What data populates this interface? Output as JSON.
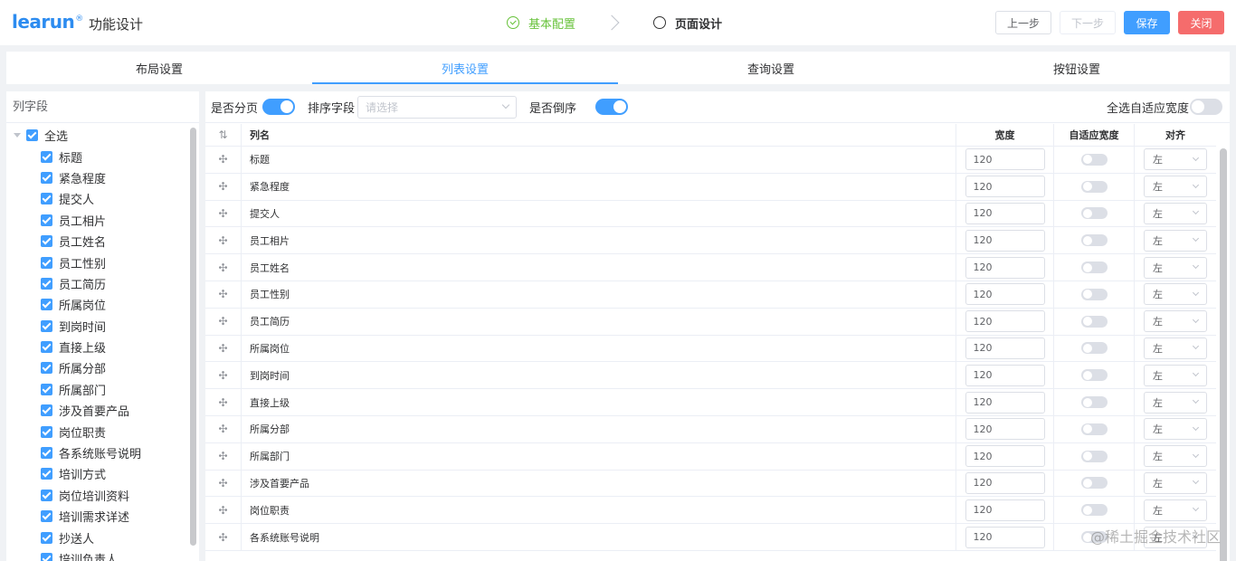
{
  "header": {
    "logo": "learun",
    "logo_mark": "®",
    "title": "功能设计",
    "steps": [
      {
        "label": "基本配置",
        "state": "done"
      },
      {
        "label": "页面设计",
        "state": "active"
      }
    ],
    "buttons": {
      "prev": "上一步",
      "next": "下一步",
      "save": "保存",
      "close": "关闭"
    }
  },
  "tabs": [
    "布局设置",
    "列表设置",
    "查询设置",
    "按钮设置"
  ],
  "active_tab": "列表设置",
  "left_panel": {
    "title": "列字段",
    "select_all": "全选",
    "items": [
      "标题",
      "紧急程度",
      "提交人",
      "员工相片",
      "员工姓名",
      "员工性别",
      "员工简历",
      "所属岗位",
      "到岗时间",
      "直接上级",
      "所属分部",
      "所属部门",
      "涉及首要产品",
      "岗位职责",
      "各系统账号说明",
      "培训方式",
      "岗位培训资料",
      "培训需求详述",
      "抄送人",
      "培训负责人"
    ]
  },
  "toolbar": {
    "paging_label": "是否分页",
    "paging_on": true,
    "sort_label": "排序字段",
    "sort_placeholder": "请选择",
    "desc_label": "是否倒序",
    "desc_on": true,
    "auto_width_all_label": "全选自适应宽度",
    "auto_width_all_on": false
  },
  "table": {
    "headers": {
      "name": "列名",
      "width": "宽度",
      "auto": "自适应宽度",
      "align": "对齐"
    },
    "rows": [
      {
        "name": "标题",
        "width": "120",
        "align": "左"
      },
      {
        "name": "紧急程度",
        "width": "120",
        "align": "左"
      },
      {
        "name": "提交人",
        "width": "120",
        "align": "左"
      },
      {
        "name": "员工相片",
        "width": "120",
        "align": "左"
      },
      {
        "name": "员工姓名",
        "width": "120",
        "align": "左"
      },
      {
        "name": "员工性别",
        "width": "120",
        "align": "左"
      },
      {
        "name": "员工简历",
        "width": "120",
        "align": "左"
      },
      {
        "name": "所属岗位",
        "width": "120",
        "align": "左"
      },
      {
        "name": "到岗时间",
        "width": "120",
        "align": "左"
      },
      {
        "name": "直接上级",
        "width": "120",
        "align": "左"
      },
      {
        "name": "所属分部",
        "width": "120",
        "align": "左"
      },
      {
        "name": "所属部门",
        "width": "120",
        "align": "左"
      },
      {
        "name": "涉及首要产品",
        "width": "120",
        "align": "左"
      },
      {
        "name": "岗位职责",
        "width": "120",
        "align": "左"
      },
      {
        "name": "各系统账号说明",
        "width": "120",
        "align": "左"
      }
    ]
  },
  "watermark": "@稀土掘金技术社区",
  "colors": {
    "primary": "#409eff",
    "success": "#67c23a",
    "danger": "#f56c6c"
  }
}
